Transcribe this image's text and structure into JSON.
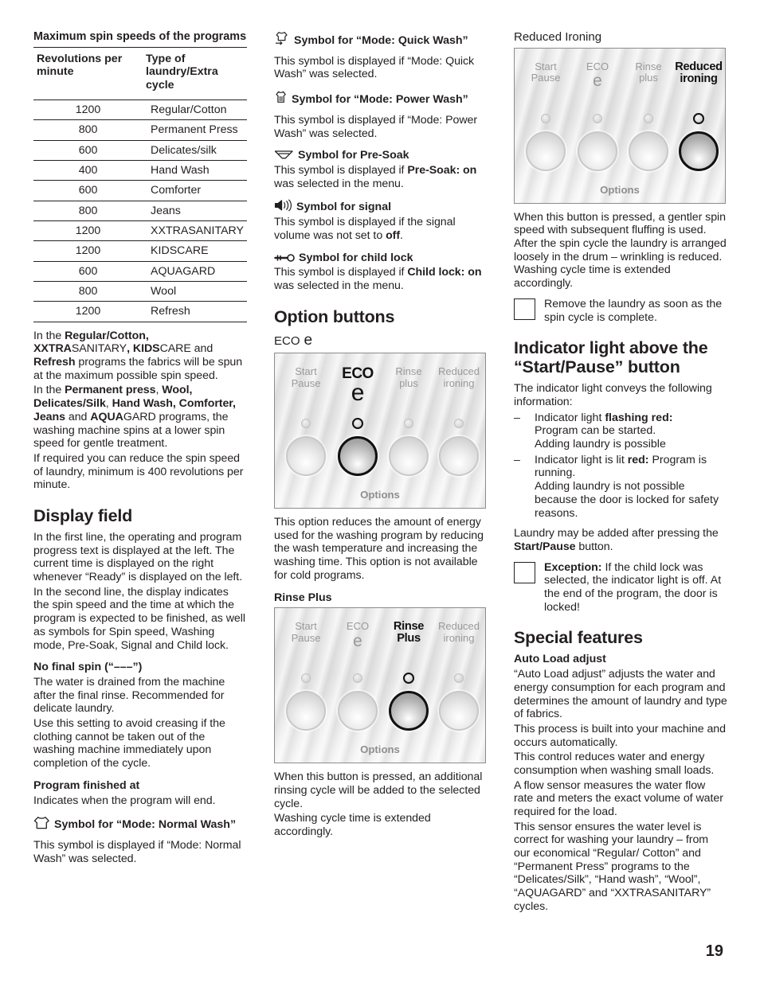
{
  "page": {
    "number": "19"
  },
  "columns": {
    "left": {
      "table": {
        "title": "Maximum spin speeds of the programs",
        "headers": [
          "Revolutions per minute",
          "Type of laundry/Extra cycle"
        ],
        "rows": [
          {
            "rpm": "1200",
            "type": "Regular/Cotton"
          },
          {
            "rpm": "800",
            "type": "Permanent Press"
          },
          {
            "rpm": "600",
            "type": "Delicates/silk"
          },
          {
            "rpm": "400",
            "type": "Hand Wash"
          },
          {
            "rpm": "600",
            "type": "Comforter"
          },
          {
            "rpm": "800",
            "type": "Jeans"
          },
          {
            "rpm": "1200",
            "type": "XXTRASANITARY"
          },
          {
            "rpm": "1200",
            "type": "KIDSCARE"
          },
          {
            "rpm": "600",
            "type": "AQUAGARD"
          },
          {
            "rpm": "800",
            "type": "Wool"
          },
          {
            "rpm": "1200",
            "type": "Refresh"
          }
        ]
      },
      "paragraphs": {
        "max_spin": "In the Regular/Cotton, XXTRASANITARY, KIDSCARE and Refresh programs the fabrics will be spun at the maximum possible spin speed.",
        "lower_spin": "In the Permanent press, Wool, Delicates/Silk, Hand Wash, Comforter, Jeans and AQUAGARD programs, the washing machine spins at a lower spin speed for gentle treatment.",
        "reduce_spin": "If required you can reduce the spin speed of laundry, minimum is 400 revolutions per minute."
      },
      "display_field": {
        "heading": "Display field",
        "p1": "In the first line, the operating and program progress text is displayed at the left. The current time is displayed on the right whenever “Ready” is displayed on the left.",
        "p2": "In the second line, the display indicates the spin speed and the time at which the program is expected to be finished, as well as symbols for Spin speed, Washing mode, Pre-Soak, Signal and Child lock.",
        "no_final_spin_heading": "No final spin (“–––”)",
        "no_final_spin_p1": "The water is drained from the machine after the final rinse. Recommended for delicate laundry.",
        "no_final_spin_p2": "Use this setting to avoid creasing if the clothing cannot be taken out of the washing machine immediately upon completion of the cycle.",
        "program_finished_heading": "Program finished at",
        "program_finished_p": "Indicates when the program will end.",
        "normal_wash_heading": "Symbol for “Mode: Normal Wash”",
        "normal_wash_icon": "tshirt-icon",
        "normal_wash_p": "This symbol is displayed if “Mode: Normal Wash” was selected."
      }
    },
    "middle": {
      "symbols": [
        {
          "icon": "quick-wash-icon",
          "heading": "Symbol for “Mode: Quick Wash”",
          "body": "This symbol is displayed if “Mode: Quick Wash” was selected."
        },
        {
          "icon": "power-wash-icon",
          "heading": "Symbol for “Mode: Power Wash”",
          "body": "This symbol is displayed if “Mode: Power Wash” was selected."
        },
        {
          "icon": "pre-soak-icon",
          "heading": "Symbol for Pre-Soak",
          "body": "This symbol is displayed if Pre-Soak: on was selected in the menu."
        },
        {
          "icon": "signal-speaker-icon",
          "heading": "Symbol for signal",
          "body": "This symbol is displayed if the signal volume was not set to off."
        },
        {
          "icon": "child-lock-key-icon",
          "heading": "Symbol for child lock",
          "body": "This symbol is displayed if Child lock: on was selected in the menu."
        }
      ],
      "option_buttons": {
        "heading": "Option buttons",
        "eco": {
          "sub_heading": "ECO",
          "sub_heading_symbol": "e",
          "panel": {
            "buttons": [
              {
                "label_line1": "Start",
                "label_line2": "Pause",
                "active": false
              },
              {
                "label_line1": "ECO",
                "label_line2": "e",
                "active": true
              },
              {
                "label_line1": "Rinse",
                "label_line2": "plus",
                "active": false
              },
              {
                "label_line1": "Reduced",
                "label_line2": "ironing",
                "active": false
              }
            ],
            "footer": "Options"
          },
          "body": "This option reduces the amount of energy used for the washing program by reducing the wash temperature and increasing the washing time.  This option is not available for cold programs."
        },
        "rinse_plus": {
          "sub_heading": "Rinse Plus",
          "panel": {
            "buttons": [
              {
                "label_line1": "Start",
                "label_line2": "Pause",
                "active": false
              },
              {
                "label_line1": "ECO",
                "label_line2": "e",
                "active": false
              },
              {
                "label_line1": "Rinse",
                "label_line2": "Plus",
                "active": true
              },
              {
                "label_line1": "Reduced",
                "label_line2": "ironing",
                "active": false
              }
            ],
            "footer": "Options"
          },
          "body1": "When this button is pressed, an additional rinsing cycle will be added to the selected cycle.",
          "body2": "Washing cycle time is extended accordingly."
        }
      }
    },
    "right": {
      "reduced_ironing": {
        "sub_heading": "Reduced Ironing",
        "panel": {
          "buttons": [
            {
              "label_line1": "Start",
              "label_line2": "Pause",
              "active": false
            },
            {
              "label_line1": "ECO",
              "label_line2": "e",
              "active": false
            },
            {
              "label_line1": "Rinse",
              "label_line2": "plus",
              "active": false
            },
            {
              "label_line1": "Reduced",
              "label_line2": "ironing",
              "active": true
            }
          ],
          "footer": "Options"
        },
        "body": "When this button is pressed, a gentler spin speed with subsequent fluffing is used. After the spin cycle the laundry is arranged loosely in the drum – wrinkling is reduced. Washing cycle time is extended accordingly.",
        "callout": "Remove the laundry as soon as the spin cycle is complete."
      },
      "indicator_light": {
        "heading": "Indicator light above the “Start/Pause” button",
        "intro": "The indicator light conveys the following information:",
        "items": [
          {
            "dash": "–",
            "text": "Indicator light flashing red: Program can be started. Adding laundry is possible"
          },
          {
            "dash": "–",
            "text": "Indicator light is lit red: Program is running. Adding laundry is not possible because the door is locked for safety reasons."
          }
        ],
        "after": "Laundry may be added after pressing the Start/Pause button.",
        "callout": "Exception: If the child lock was selected, the indicator light is off. At the end of the program, the door is locked!"
      },
      "special_features": {
        "heading": "Special features",
        "sub_heading": "Auto Load adjust",
        "p1": "“Auto Load adjust” adjusts the water and energy consumption for each program and determines the amount of laundry and type of fabrics.",
        "p2": "This process is built into your machine and occurs automatically.",
        "p3": "This control reduces water and energy consumption when washing small loads.",
        "p4": "A flow sensor measures the water flow rate and meters the exact volume of water required for the load.",
        "p5": "This sensor ensures the water level is correct for washing your laundry – from our economical “Regular/ Cotton” and “Permanent Press” programs to the “Delicates/Silk”, “Hand wash”, “Wool”, “AQUAGARD” and “XXTRASANITARY” cycles."
      }
    }
  },
  "colors": {
    "text": "#231f20",
    "panel_label_inactive": "#9a9a9a",
    "panel_label_active": "#111111",
    "panel_bg": "#ececec",
    "panel_border": "#8c8c8c"
  }
}
